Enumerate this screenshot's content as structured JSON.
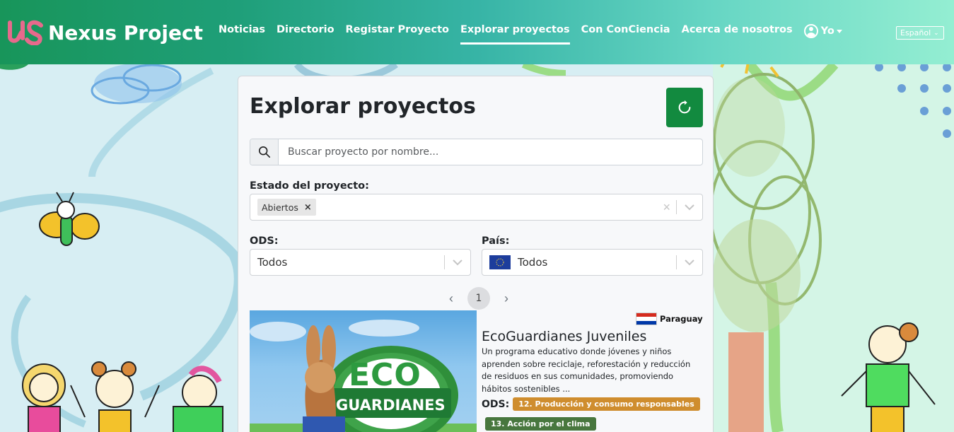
{
  "navbar": {
    "brand": "Nexus Project",
    "links": [
      {
        "label": "Noticias",
        "active": false
      },
      {
        "label": "Directorio",
        "active": false
      },
      {
        "label": "Registar Proyecto",
        "active": false
      },
      {
        "label": "Explorar proyectos",
        "active": true
      },
      {
        "label": "Con ConCiencia",
        "active": false
      },
      {
        "label": "Acerca de nosotros",
        "active": false
      }
    ],
    "user_label": "Yo",
    "language": "Español"
  },
  "main": {
    "title": "Explorar proyectos",
    "search": {
      "placeholder": "Buscar proyecto por nombre...",
      "value": ""
    },
    "status_filter": {
      "label": "Estado del proyecto:",
      "selected": [
        "Abiertos"
      ]
    },
    "ods_filter": {
      "label": "ODS:",
      "value": "Todos"
    },
    "country_filter": {
      "label": "País:",
      "value": "Todos"
    },
    "pagination": {
      "current_page": "1"
    }
  },
  "project": {
    "country": "Paraguay",
    "title": "EcoGuardianes Juveniles",
    "description": "Un programa educativo donde jóvenes y niños aprenden sobre reciclaje, reforestación y reducción de residuos en sus comunidades, promoviendo hábitos sostenibles ...",
    "ods_label": "ODS:",
    "image_text": [
      "ECO",
      "GUARDIANES"
    ],
    "ods_badges": [
      {
        "label": "12. Producción y consumo responsables",
        "color": "#cf8d2e"
      },
      {
        "label": "13. Acción por el clima",
        "color": "#48773e"
      }
    ]
  },
  "colors": {
    "accent_green": "#128a3f",
    "navbar_start": "#18955a",
    "navbar_end": "#94eed2"
  }
}
